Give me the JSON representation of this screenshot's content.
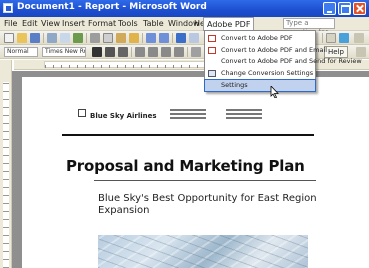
{
  "window": {
    "title": "Document1 - Report - Microsoft Word"
  },
  "menubar": {
    "items": [
      "File",
      "Edit",
      "View",
      "Insert",
      "Format",
      "Tools",
      "Table",
      "Window",
      "Help",
      "Adobe PDF"
    ],
    "help_placeholder": "Type a question for help"
  },
  "toolbar2": {
    "style_value": "Normal",
    "font_value": "Times New Roman",
    "button_label": "Help"
  },
  "adobe_pdf_menu": {
    "items": [
      "Convert to Adobe PDF",
      "Convert to Adobe PDF and Email",
      "Convert to Adobe PDF and Send for Review",
      "Change Conversion Settings",
      "Settings"
    ]
  },
  "document": {
    "company": "Blue Sky Airlines",
    "title": "Proposal and Marketing Plan",
    "subtitle": "Blue Sky's Best Opportunity for East Region Expansion"
  },
  "colors": {
    "titlebar": "#1d4fd0",
    "menu_bg": "#ece9d8",
    "desk": "#8f8f8f",
    "highlight": "#c1d2ee"
  }
}
